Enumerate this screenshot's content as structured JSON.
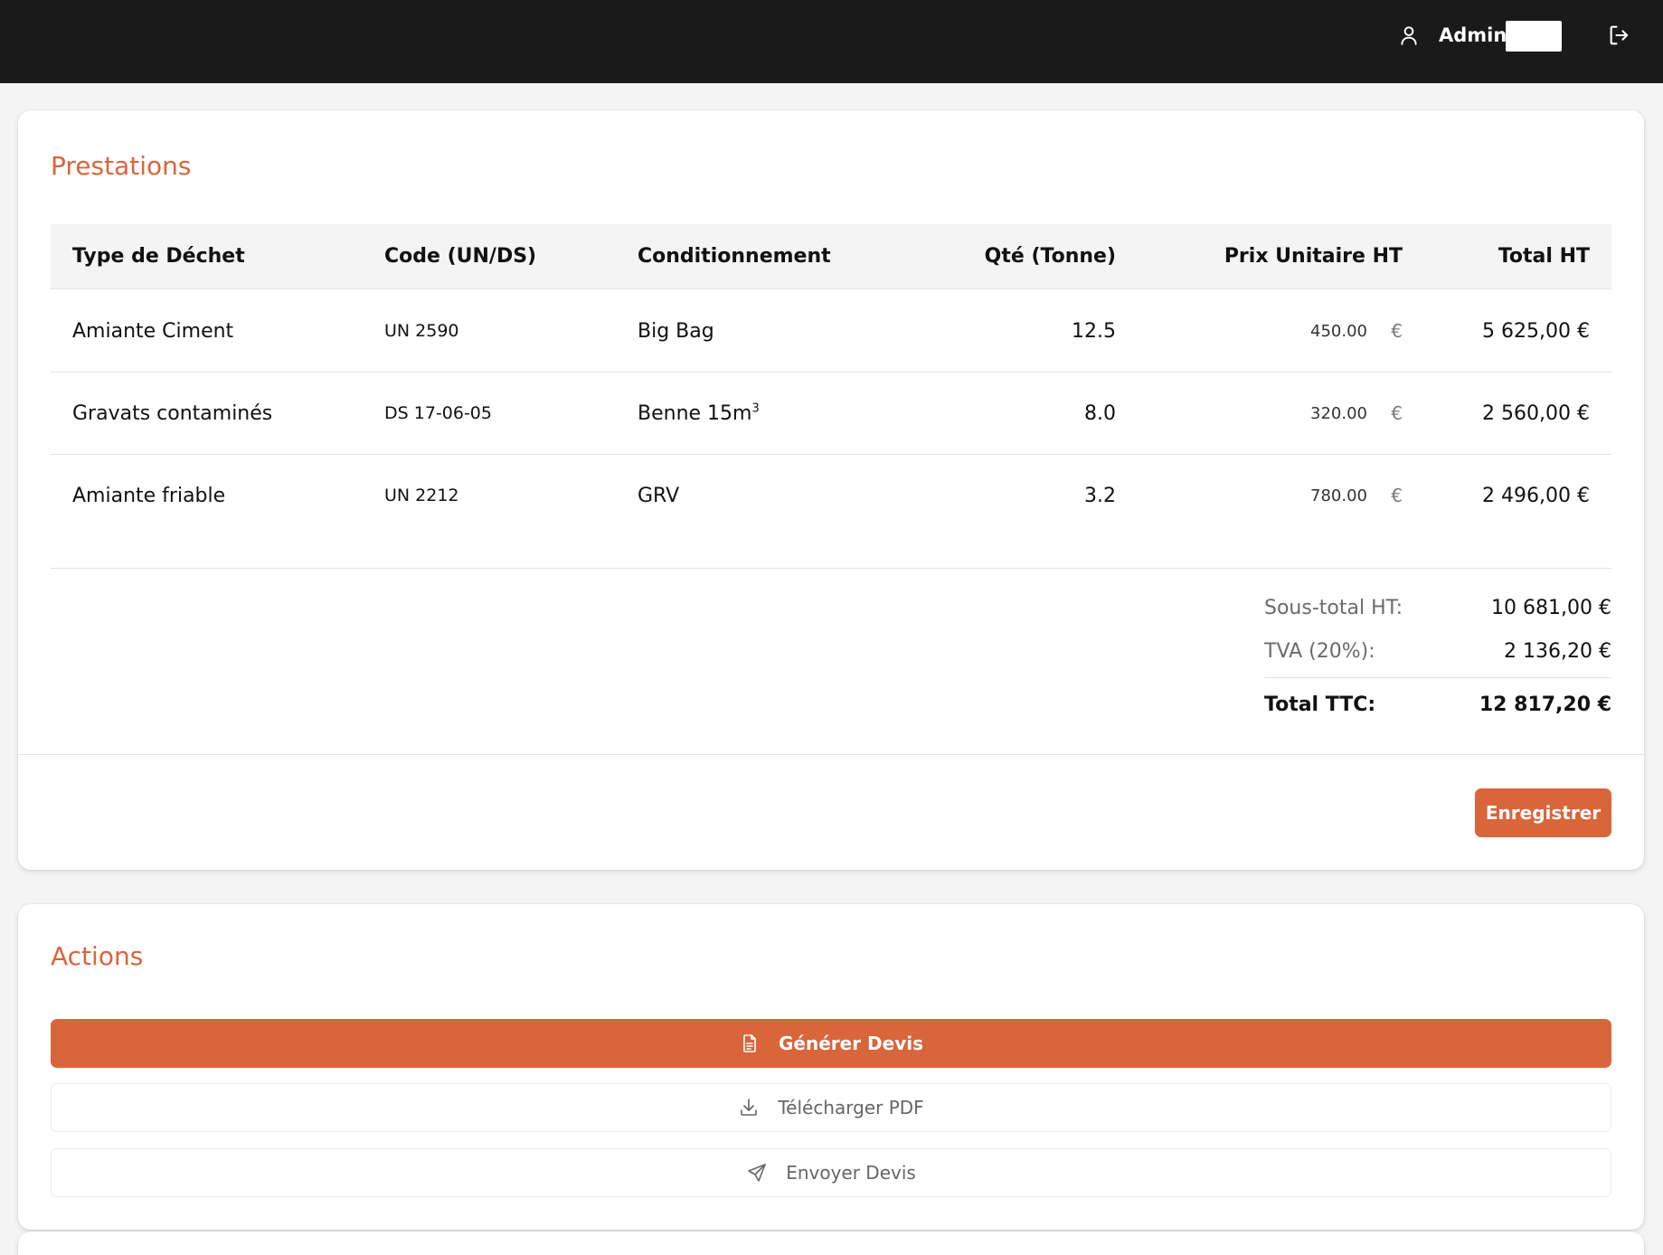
{
  "header": {
    "user_label": "Admin",
    "user_icon": "user-icon",
    "logout_icon": "logout-icon"
  },
  "prestations": {
    "title": "Prestations",
    "columns": {
      "type": "Type de Déchet",
      "code": "Code (UN/DS)",
      "conditionnement": "Conditionnement",
      "qte": "Qté (Tonne)",
      "prix": "Prix Unitaire HT",
      "total": "Total HT"
    },
    "rows": [
      {
        "type": "Amiante Ciment",
        "code": "UN 2590",
        "conditionnement": "Big Bag",
        "conditionnement_sup": "",
        "qte": "12.5",
        "prix": "450.00",
        "currency": "€",
        "total": "5 625,00 €"
      },
      {
        "type": "Gravats contaminés",
        "code": "DS 17-06-05",
        "conditionnement": "Benne 15m",
        "conditionnement_sup": "3",
        "qte": "8.0",
        "prix": "320.00",
        "currency": "€",
        "total": "2 560,00 €"
      },
      {
        "type": "Amiante friable",
        "code": "UN 2212",
        "conditionnement": "GRV",
        "conditionnement_sup": "",
        "qte": "3.2",
        "prix": "780.00",
        "currency": "€",
        "total": "2 496,00 €"
      }
    ],
    "summary": {
      "subtotal_label": "Sous-total HT:",
      "subtotal_value": "10 681,00 €",
      "tva_label": "TVA (20%):",
      "tva_value": "2 136,20 €",
      "total_label": "Total TTC:",
      "total_value": "12 817,20 €"
    },
    "save_label": "Enregistrer"
  },
  "actions": {
    "title": "Actions",
    "generate_label": "Générer Devis",
    "generate_icon": "document-icon",
    "download_label": "Télécharger PDF",
    "download_icon": "download-icon",
    "send_label": "Envoyer Devis",
    "send_icon": "send-icon"
  },
  "colors": {
    "accent": "#d9653b",
    "topbar": "#1a1a1a",
    "background": "#f4f4f4"
  }
}
